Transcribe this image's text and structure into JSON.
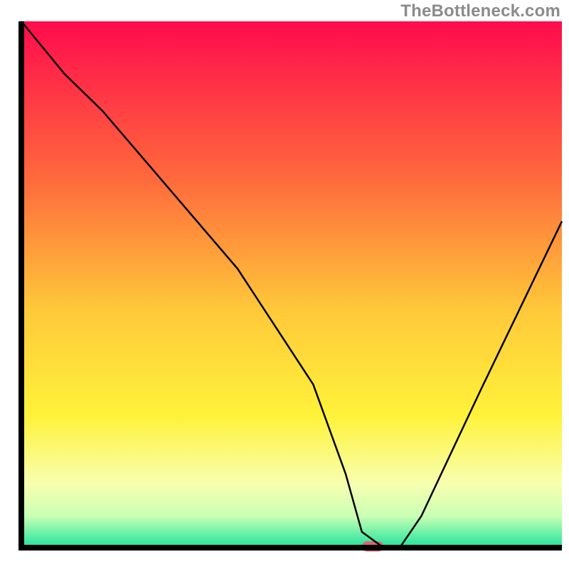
{
  "attribution": "TheBottleneck.com",
  "chart_data": {
    "type": "line",
    "title": "",
    "xlabel": "",
    "ylabel": "",
    "xlim": [
      0,
      100
    ],
    "ylim": [
      0,
      100
    ],
    "x": [
      0,
      8,
      15,
      25,
      40,
      54,
      60,
      63,
      67,
      70,
      74,
      85,
      100
    ],
    "values": [
      100,
      90,
      83,
      71,
      53,
      31,
      14,
      3,
      0,
      0,
      6,
      30,
      62
    ],
    "gradient_stops": [
      {
        "offset": 0,
        "color": "#ff0b4d"
      },
      {
        "offset": 30,
        "color": "#ff6a3c"
      },
      {
        "offset": 55,
        "color": "#ffc93a"
      },
      {
        "offset": 75,
        "color": "#fff23a"
      },
      {
        "offset": 88,
        "color": "#f7ffb0"
      },
      {
        "offset": 94,
        "color": "#c9ffb4"
      },
      {
        "offset": 100,
        "color": "#1de39b"
      }
    ],
    "marker": {
      "x": 65,
      "y": 0,
      "color": "#d9646d",
      "w": 4,
      "h": 1.2
    },
    "axes": {
      "thickness": 4,
      "color": "#000000"
    }
  }
}
